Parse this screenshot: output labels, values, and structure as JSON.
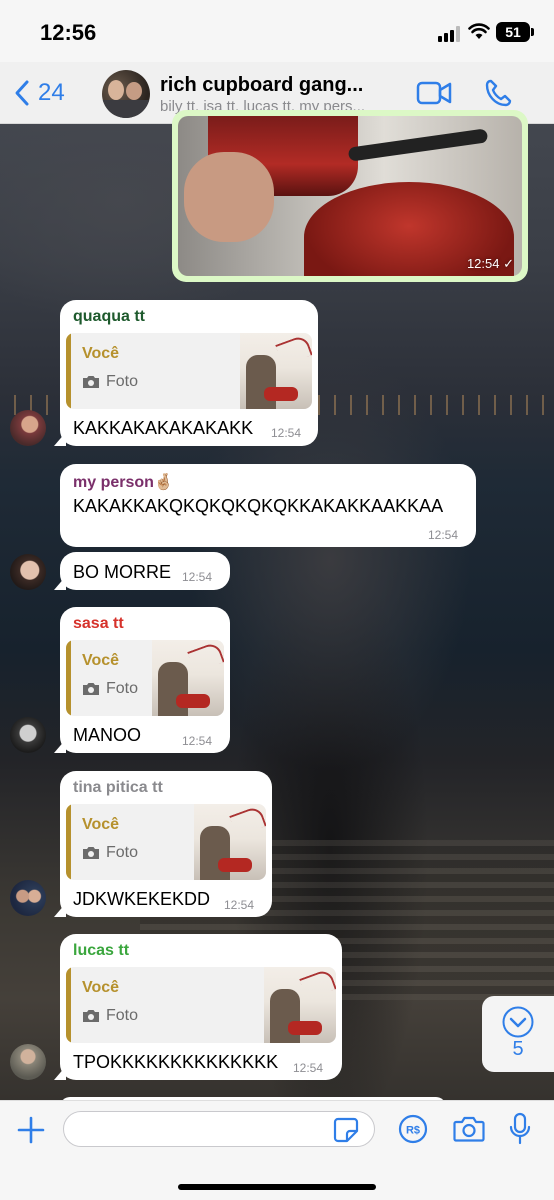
{
  "status_bar": {
    "time": "12:56",
    "battery": "51"
  },
  "header": {
    "back_count": "24",
    "title": "rich cupboard gang...",
    "subtitle": "bily tt, isa tt, lucas tt, my pers..."
  },
  "image_message": {
    "time": "12:54"
  },
  "messages": [
    {
      "sender": "quaqua tt",
      "sender_color": "#1e5a2d",
      "reply_name": "Você",
      "reply_type": "Foto",
      "text": "KAKKAKAKAKAKAKK",
      "time": "12:54"
    },
    {
      "sender": "my person🤞🏼",
      "sender_color": "#7a2f6a",
      "text": "KAKAKKAKQKQKQKQKQKKAKAKKAAKKAA",
      "time": "12:54"
    },
    {
      "text": "BO MORRE",
      "time": "12:54"
    },
    {
      "sender": "sasa tt",
      "sender_color": "#d6322b",
      "reply_name": "Você",
      "reply_type": "Foto",
      "text": "MANOO",
      "time": "12:54"
    },
    {
      "sender": "tina pitica tt",
      "sender_color": "#8a8a8e",
      "reply_name": "Você",
      "reply_type": "Foto",
      "text": "JDKWKEKEKDD",
      "time": "12:54"
    },
    {
      "sender": "lucas tt",
      "sender_color": "#3aa63d",
      "reply_name": "Você",
      "reply_type": "Foto",
      "text": "TPOKKKKKKKKKKKKKK",
      "time": "12:54"
    }
  ],
  "scroll_down": {
    "unread_count": "5"
  },
  "composer": {
    "placeholder": ""
  },
  "colors": {
    "accent": "#2f7ee8",
    "outgoing_bubble": "#dcf8c6",
    "reply_bar": "#b6912d"
  }
}
